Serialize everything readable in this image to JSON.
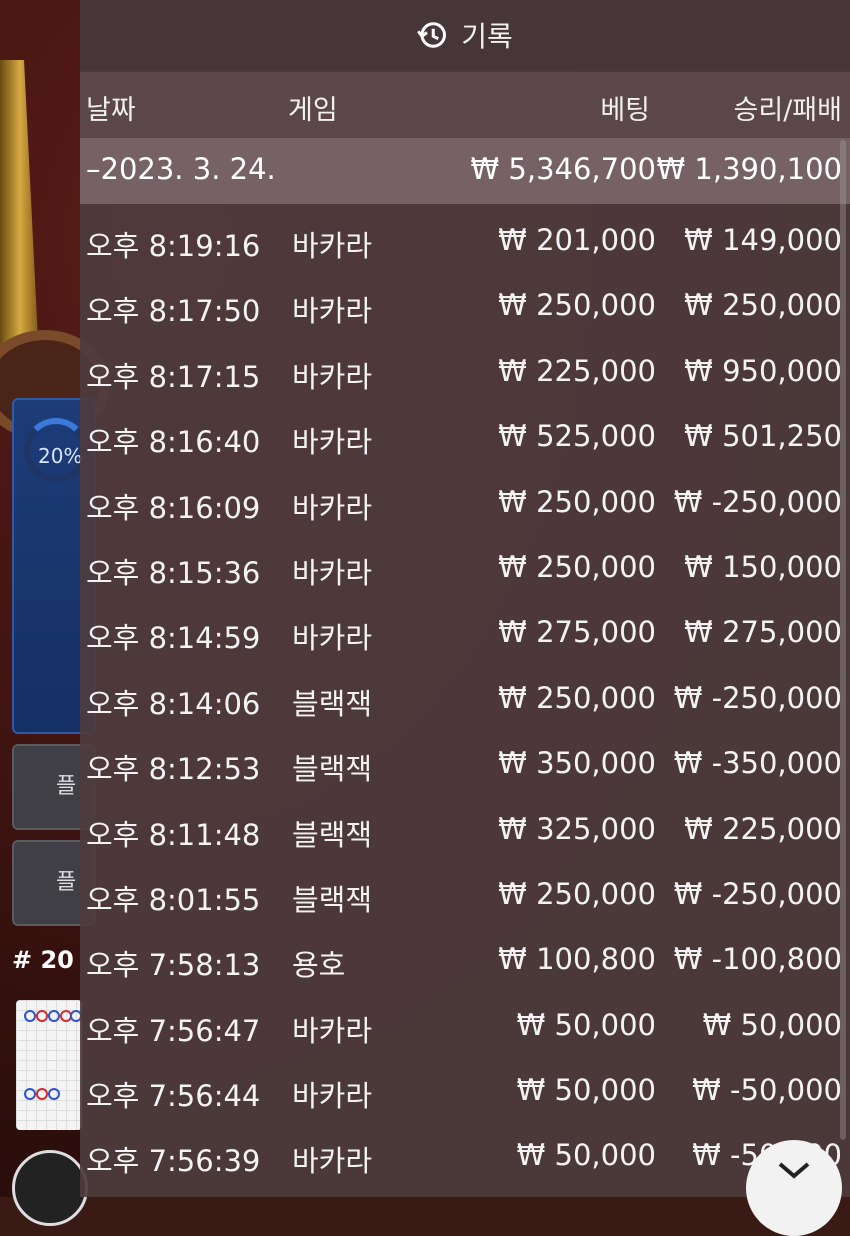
{
  "background": {
    "progress_label": "20%",
    "button_1_text": "플",
    "button_2_text": "플",
    "table_number": "# 20"
  },
  "header": {
    "title": "기록",
    "icon": "history-icon"
  },
  "columns": {
    "date": "날짜",
    "game": "게임",
    "bet": "베팅",
    "result": "승리/패배"
  },
  "summary": {
    "date": "–2023. 3. 24.",
    "bet": "₩ 5,346,700",
    "result": "₩ 1,390,100"
  },
  "rows": [
    {
      "time": "오후 8:19:16",
      "game": "바카라",
      "bet": "₩ 201,000",
      "result": "₩ 149,000"
    },
    {
      "time": "오후 8:17:50",
      "game": "바카라",
      "bet": "₩ 250,000",
      "result": "₩ 250,000"
    },
    {
      "time": "오후 8:17:15",
      "game": "바카라",
      "bet": "₩ 225,000",
      "result": "₩ 950,000"
    },
    {
      "time": "오후 8:16:40",
      "game": "바카라",
      "bet": "₩ 525,000",
      "result": "₩ 501,250"
    },
    {
      "time": "오후 8:16:09",
      "game": "바카라",
      "bet": "₩ 250,000",
      "result": "₩ -250,000"
    },
    {
      "time": "오후 8:15:36",
      "game": "바카라",
      "bet": "₩ 250,000",
      "result": "₩ 150,000"
    },
    {
      "time": "오후 8:14:59",
      "game": "바카라",
      "bet": "₩ 275,000",
      "result": "₩ 275,000"
    },
    {
      "time": "오후 8:14:06",
      "game": "블랙잭",
      "bet": "₩ 250,000",
      "result": "₩ -250,000"
    },
    {
      "time": "오후 8:12:53",
      "game": "블랙잭",
      "bet": "₩ 350,000",
      "result": "₩ -350,000"
    },
    {
      "time": "오후 8:11:48",
      "game": "블랙잭",
      "bet": "₩ 325,000",
      "result": "₩ 225,000"
    },
    {
      "time": "오후 8:01:55",
      "game": "블랙잭",
      "bet": "₩ 250,000",
      "result": "₩ -250,000"
    },
    {
      "time": "오후 7:58:13",
      "game": "용호",
      "bet": "₩ 100,800",
      "result": "₩ -100,800"
    },
    {
      "time": "오후 7:56:47",
      "game": "바카라",
      "bet": "₩ 50,000",
      "result": "₩ 50,000"
    },
    {
      "time": "오후 7:56:44",
      "game": "바카라",
      "bet": "₩ 50,000",
      "result": "₩ -50,000"
    },
    {
      "time": "오후 7:56:39",
      "game": "바카라",
      "bet": "₩ 50,000",
      "result": "₩ -50,000"
    }
  ]
}
